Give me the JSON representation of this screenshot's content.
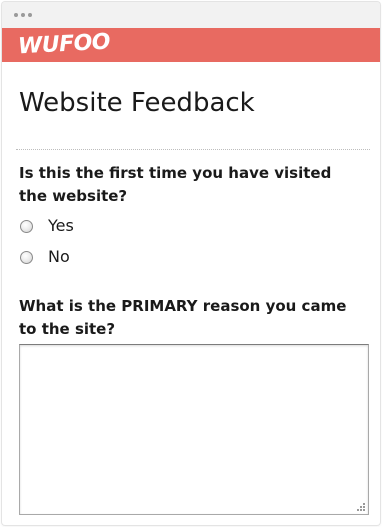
{
  "brand": {
    "logo_text": "WUFOO",
    "bar_color": "#e86a61"
  },
  "form": {
    "title": "Website Feedback",
    "questions": [
      {
        "label": "Is this the first time you have visited the website?",
        "type": "radio",
        "options": [
          "Yes",
          "No"
        ],
        "selected": null
      },
      {
        "label": "What is the PRIMARY reason you came to the site?",
        "type": "textarea",
        "value": ""
      }
    ]
  }
}
